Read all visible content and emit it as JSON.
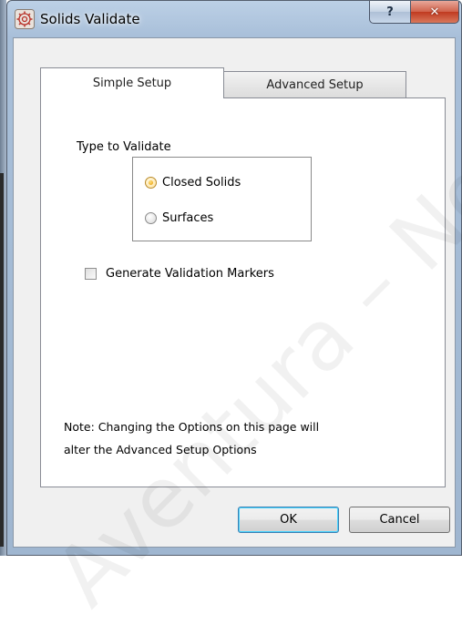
{
  "window": {
    "title": "Solids Validate",
    "help_glyph": "?",
    "close_glyph": "✕"
  },
  "tabs": [
    {
      "label": "Simple Setup",
      "selected": true
    },
    {
      "label": "Advanced Setup",
      "selected": false
    }
  ],
  "type_group": {
    "label": "Type to Validate",
    "options": [
      {
        "label": "Closed Solids",
        "checked": true
      },
      {
        "label": "Surfaces",
        "checked": false
      }
    ]
  },
  "generate_markers": {
    "label": "Generate Validation Markers",
    "checked": false
  },
  "note": {
    "line1": "Note: Changing the Options on this page will",
    "line2": "alter the Advanced Setup Options"
  },
  "buttons": {
    "ok": "OK",
    "cancel": "Cancel"
  },
  "watermark": "Aventura – Nov",
  "colors": {
    "close_button": "#c8452c",
    "radio_selected": "#e89a00",
    "ok_focus": "#3c7fb1"
  }
}
